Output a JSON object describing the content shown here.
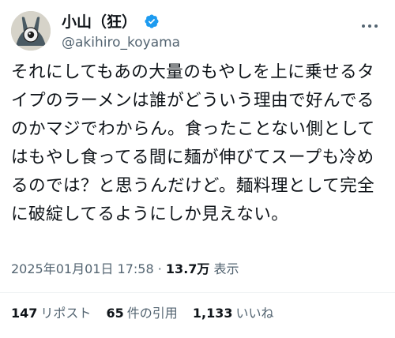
{
  "author": {
    "display_name": "小山（狂）",
    "handle": "@akihiro_koyama",
    "avatar_icon": "avatar-eye-figure-icon",
    "verified_icon": "verified-badge-icon",
    "verified_color": "#1d9bf0"
  },
  "more_icon": "more-options-icon",
  "tweet": {
    "text": "それにしてもあの大量のもやしを上に乗せるタイプのラーメンは誰がどういう理由で好んでるのかマジでわからん。食ったことない側としてはもやし食ってる間に麺が伸びてスープも冷めるのでは？と思うんだけど。麺料理として完全に破綻してるようにしか見えない。"
  },
  "meta": {
    "timestamp": "2025年01月01日 17:58",
    "separator": "·",
    "views_count": "13.7万",
    "views_label": "表示"
  },
  "stats": {
    "reposts_count": "147",
    "reposts_label": "リポスト",
    "quotes_count": "65",
    "quotes_label": "件の引用",
    "likes_count": "1,133",
    "likes_label": "いいね"
  }
}
